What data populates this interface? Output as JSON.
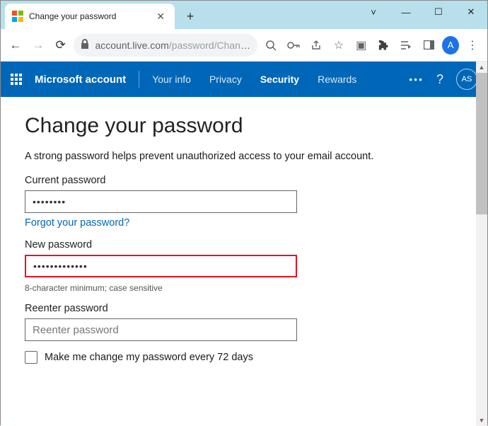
{
  "browser": {
    "tab_title": "Change your password",
    "url_host": "account.live.com",
    "url_path": "/password/Chang…",
    "avatar_letter": "A"
  },
  "header": {
    "brand": "Microsoft account",
    "nav": {
      "your_info": "Your info",
      "privacy": "Privacy",
      "security": "Security",
      "rewards": "Rewards"
    },
    "account_initials": "AS"
  },
  "page": {
    "title": "Change your password",
    "description": "A strong password helps prevent unauthorized access to your email account.",
    "current_password_label": "Current password",
    "current_password_value": "••••••••",
    "forgot_link": "Forgot your password?",
    "new_password_label": "New password",
    "new_password_value": "•••••••••••••",
    "hint": "8-character minimum; case sensitive",
    "reenter_label": "Reenter password",
    "reenter_placeholder": "Reenter password",
    "checkbox_label": "Make me change my password every 72 days"
  }
}
